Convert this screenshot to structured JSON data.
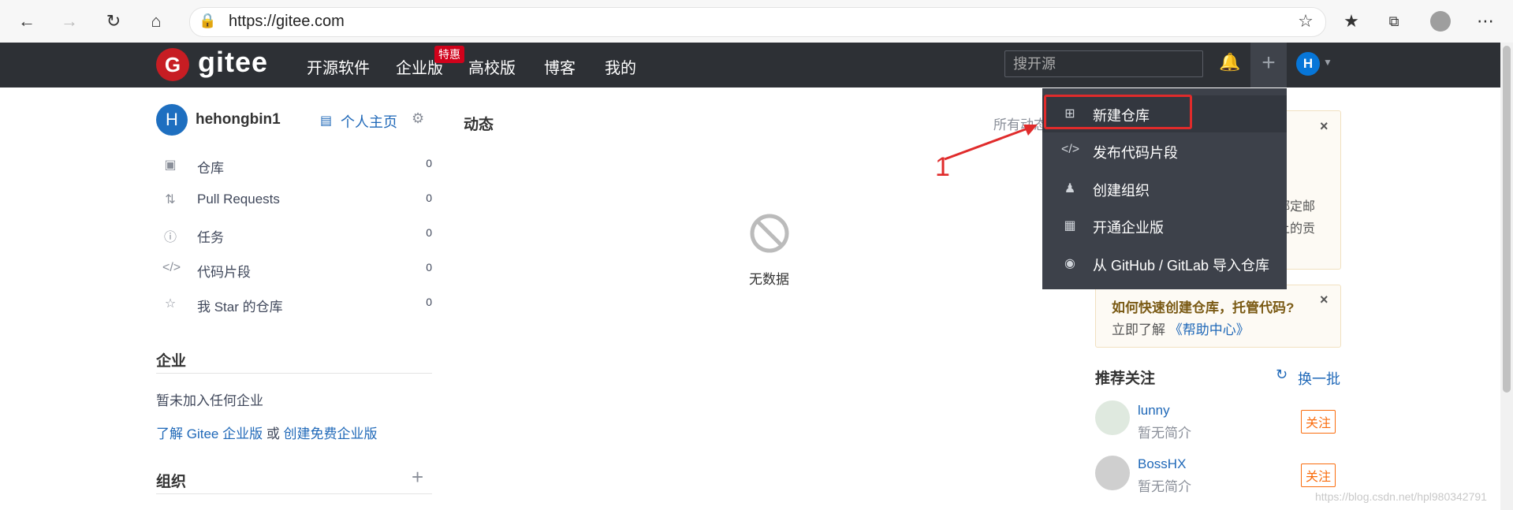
{
  "browser": {
    "url": "https://gitee.com"
  },
  "header": {
    "logo_text": "gitee",
    "logo_letter": "G",
    "nav": [
      "开源软件",
      "企业版",
      "高校版",
      "博客",
      "我的"
    ],
    "badge": "特惠",
    "search_placeholder": "搜开源",
    "avatar_letter": "H",
    "plus": "+"
  },
  "sidebar": {
    "avatar_letter": "H",
    "username": "hehongbin1",
    "homepage": "个人主页",
    "items": [
      {
        "label": "仓库",
        "count": "0",
        "icon": "repo-icon"
      },
      {
        "label": "Pull Requests",
        "count": "0",
        "icon": "pull-request-icon"
      },
      {
        "label": "任务",
        "count": "0",
        "icon": "issue-icon"
      },
      {
        "label": "代码片段",
        "count": "0",
        "icon": "code-icon"
      },
      {
        "label": "我 Star 的仓库",
        "count": "0",
        "icon": "star-icon"
      }
    ],
    "enterprise_title": "企业",
    "enterprise_none": "暂未加入任何企业",
    "enterprise_link1": "了解 Gitee 企业版",
    "enterprise_or": " 或 ",
    "enterprise_link2": "创建免费企业版",
    "org_title": "组织"
  },
  "main": {
    "title": "动态",
    "filter": "所有动态",
    "no_data": "无数据"
  },
  "dropdown": {
    "items": [
      {
        "label": "新建仓库",
        "icon": "square-plus-icon"
      },
      {
        "label": "发布代码片段",
        "icon": "code-icon"
      },
      {
        "label": "创建组织",
        "icon": "group-icon"
      },
      {
        "label": "开通企业版",
        "icon": "building-icon"
      },
      {
        "label": "从 GitHub / GitLab 导入仓库",
        "icon": "github-icon"
      }
    ]
  },
  "annotation": {
    "number": "1",
    "color": "#e02b2b"
  },
  "right": {
    "card1_partial_line1": "绑定邮",
    "card1_partial_line2": "上的贡",
    "card2_title": "如何快速创建仓库，托管代码?",
    "card2_text": "立即了解 ",
    "card2_link": "《帮助中心》",
    "recommend_title": "推荐关注",
    "refresh": "换一批",
    "users": [
      {
        "name": "lunny",
        "bio": "暂无简介",
        "button": "关注"
      },
      {
        "name": "BossHX",
        "bio": "暂无简介",
        "button": "关注"
      }
    ]
  },
  "watermark": "https://blog.csdn.net/hpl980342791"
}
